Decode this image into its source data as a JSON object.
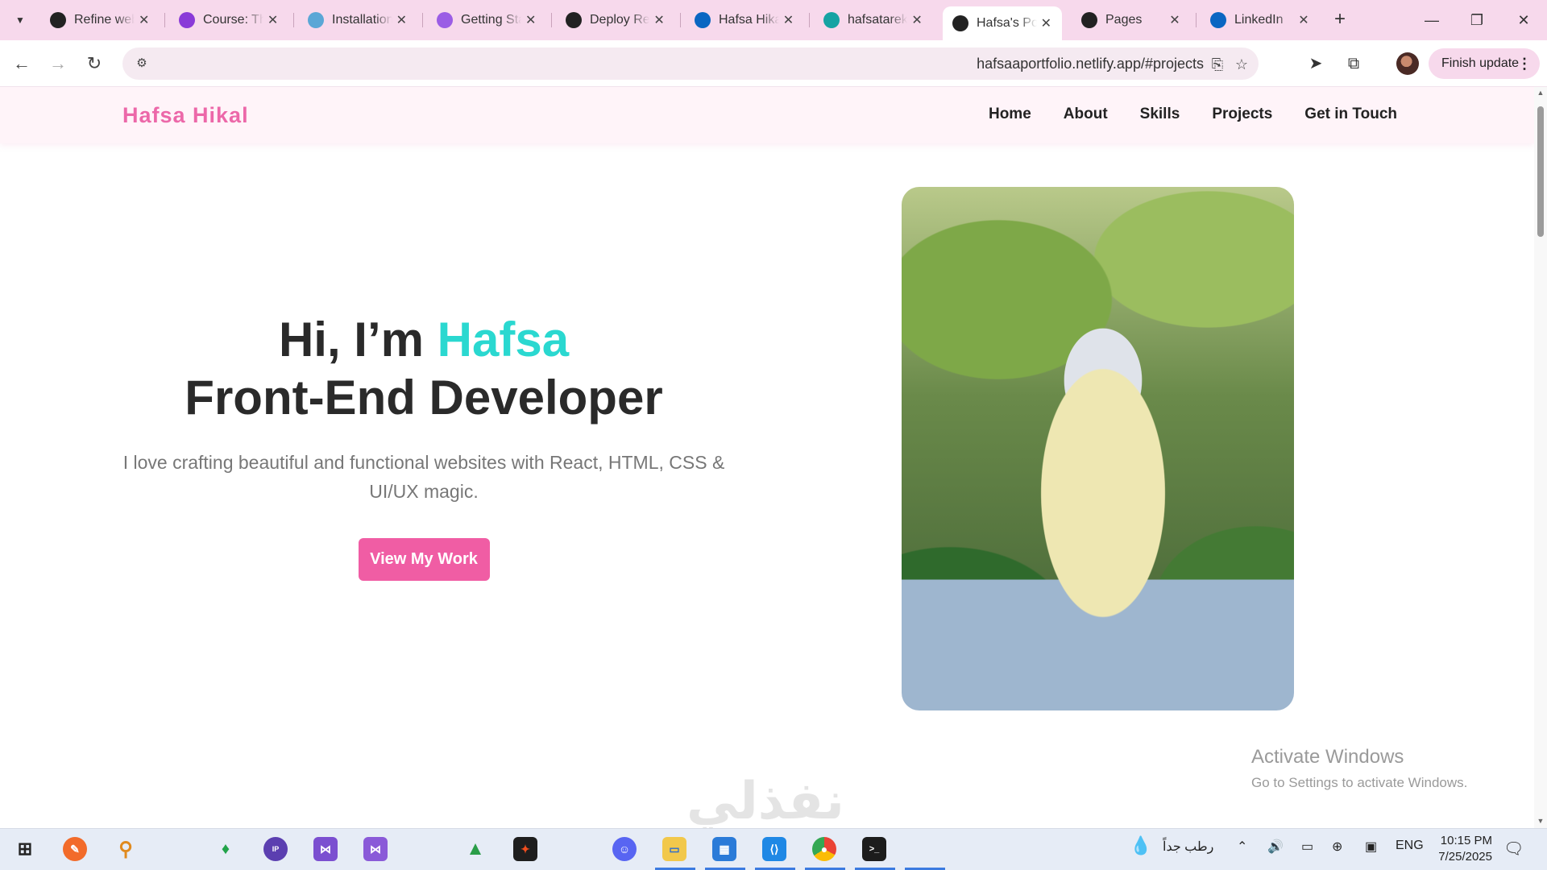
{
  "browser": {
    "tabs": [
      {
        "title": "Refine web",
        "favicon": "openai-icon",
        "color": "#222222"
      },
      {
        "title": "Course: Th",
        "favicon": "course-icon",
        "color": "#8a3ad8"
      },
      {
        "title": "Installation",
        "favicon": "react-icon",
        "color": "#5aa7d6"
      },
      {
        "title": "Getting Sta",
        "favicon": "vite-icon",
        "color": "#9b5de5"
      },
      {
        "title": "Deploy Re",
        "favicon": "openai-icon",
        "color": "#222222"
      },
      {
        "title": "Hafsa Hika",
        "favicon": "linkedin-icon",
        "color": "#0a66c2"
      },
      {
        "title": "hafsatarek",
        "favicon": "netlify-icon",
        "color": "#15a3a3"
      },
      {
        "title": "Hafsa's Po",
        "favicon": "openai-icon",
        "color": "#222222",
        "active": true
      },
      {
        "title": "Pages",
        "favicon": "github-icon",
        "color": "#222222"
      },
      {
        "title": "LinkedIn",
        "favicon": "linkedin-icon",
        "color": "#0a66c2"
      }
    ],
    "url": "hafsaaportfolio.netlify.app/#projects",
    "finish_update_label": "Finish update"
  },
  "site": {
    "logo": "Hafsa Hikal",
    "nav": [
      "Home",
      "About",
      "Skills",
      "Projects",
      "Get in Touch"
    ],
    "hero": {
      "greeting_prefix": "Hi, I’m ",
      "name": "Hafsa",
      "role": "Front-End Developer",
      "description": "I love crafting beautiful and functional websites with React, HTML, CSS & UI/UX magic.",
      "cta": "View My Work"
    }
  },
  "overlay": {
    "activate_title": "Activate Windows",
    "activate_sub": "Go to Settings to activate Windows.",
    "arabic_logo": "نفذلي"
  },
  "taskbar": {
    "weather": "رطب جداً",
    "language": "ENG",
    "time": "10:15 PM",
    "date": "7/25/2025"
  }
}
